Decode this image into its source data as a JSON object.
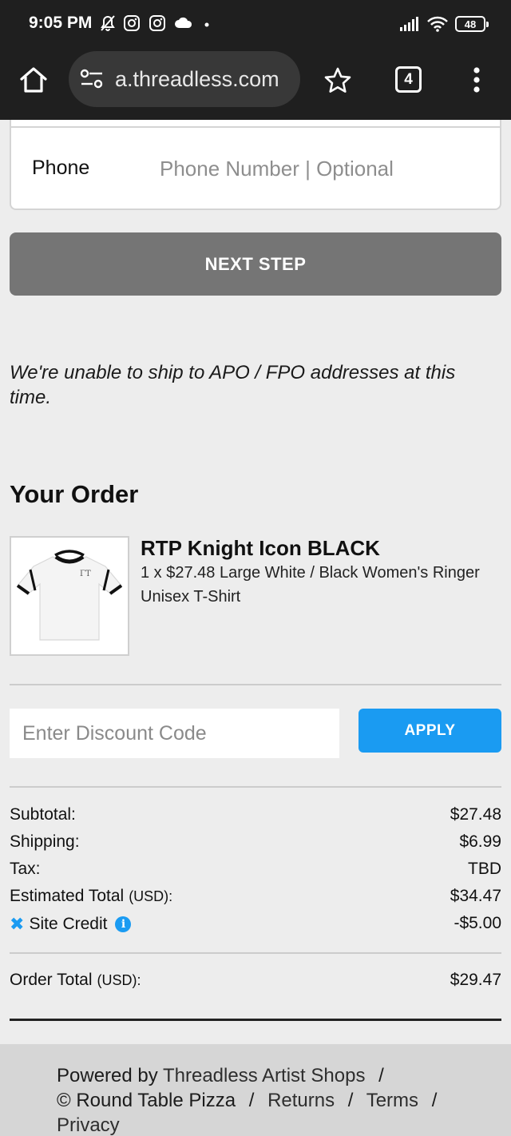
{
  "status_bar": {
    "time": "9:05 PM",
    "battery": "48"
  },
  "browser": {
    "url": "a.threadless.com",
    "tab_count": "4"
  },
  "contact_form": {
    "phone_label": "Phone",
    "phone_placeholder": "Phone Number | Optional"
  },
  "next_step_label": "NEXT STEP",
  "shipping_note": "We're unable to ship to APO / FPO addresses at this time.",
  "order": {
    "heading": "Your Order",
    "item": {
      "title": "RTP Knight Icon BLACK",
      "description": "1 x $27.48 Large White / Black Women's Ringer Unisex T-Shirt"
    }
  },
  "discount": {
    "placeholder": "Enter Discount Code",
    "apply_label": "APPLY"
  },
  "summary": {
    "subtotal_label": "Subtotal:",
    "subtotal_value": "$27.48",
    "shipping_label": "Shipping:",
    "shipping_value": "$6.99",
    "tax_label": "Tax:",
    "tax_value": "TBD",
    "estimated_label": "Estimated Total",
    "estimated_currency": "(USD):",
    "estimated_value": "$34.47",
    "credit_x": "✖",
    "credit_label": "Site Credit",
    "credit_value": "-$5.00",
    "order_total_label": "Order Total",
    "order_total_currency": "(USD):",
    "order_total_value": "$29.47"
  },
  "footer": {
    "powered_by": "Powered by",
    "shop_link": "Threadless Artist Shops",
    "copyright": "© Round Table Pizza",
    "returns": "Returns",
    "terms": "Terms",
    "privacy": "Privacy",
    "separator": "/"
  },
  "colors": {
    "accent": "#1a9bf2",
    "next_step_bg": "#757575",
    "page_bg": "#ededed"
  }
}
